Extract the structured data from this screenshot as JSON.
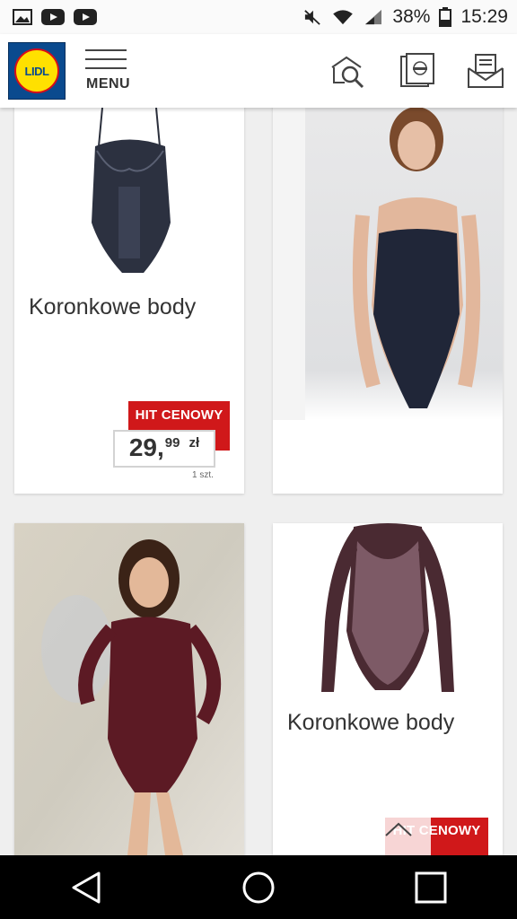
{
  "status_bar": {
    "battery": "38%",
    "time": "15:29",
    "icons": [
      "image-icon",
      "youtube-icon",
      "youtube-icon",
      "mute-icon",
      "wifi-icon",
      "signal-icon",
      "battery-icon"
    ]
  },
  "header": {
    "logo_text": "LIDL",
    "menu_label": "MENU",
    "icons": [
      "search-icon",
      "leaflet-icon",
      "mail-icon"
    ]
  },
  "products": [
    {
      "title": "Koronkowe body",
      "badge": "HIT CENOWY",
      "price_main": "29,",
      "price_cents": "99",
      "currency": "zł",
      "unit": "1 szt."
    },
    {
      "title": "Koronkowe body",
      "badge": "HIT CENOWY"
    }
  ],
  "colors": {
    "brand_blue": "#0a4a8e",
    "brand_yellow": "#ffe000",
    "brand_red": "#d0181a"
  }
}
